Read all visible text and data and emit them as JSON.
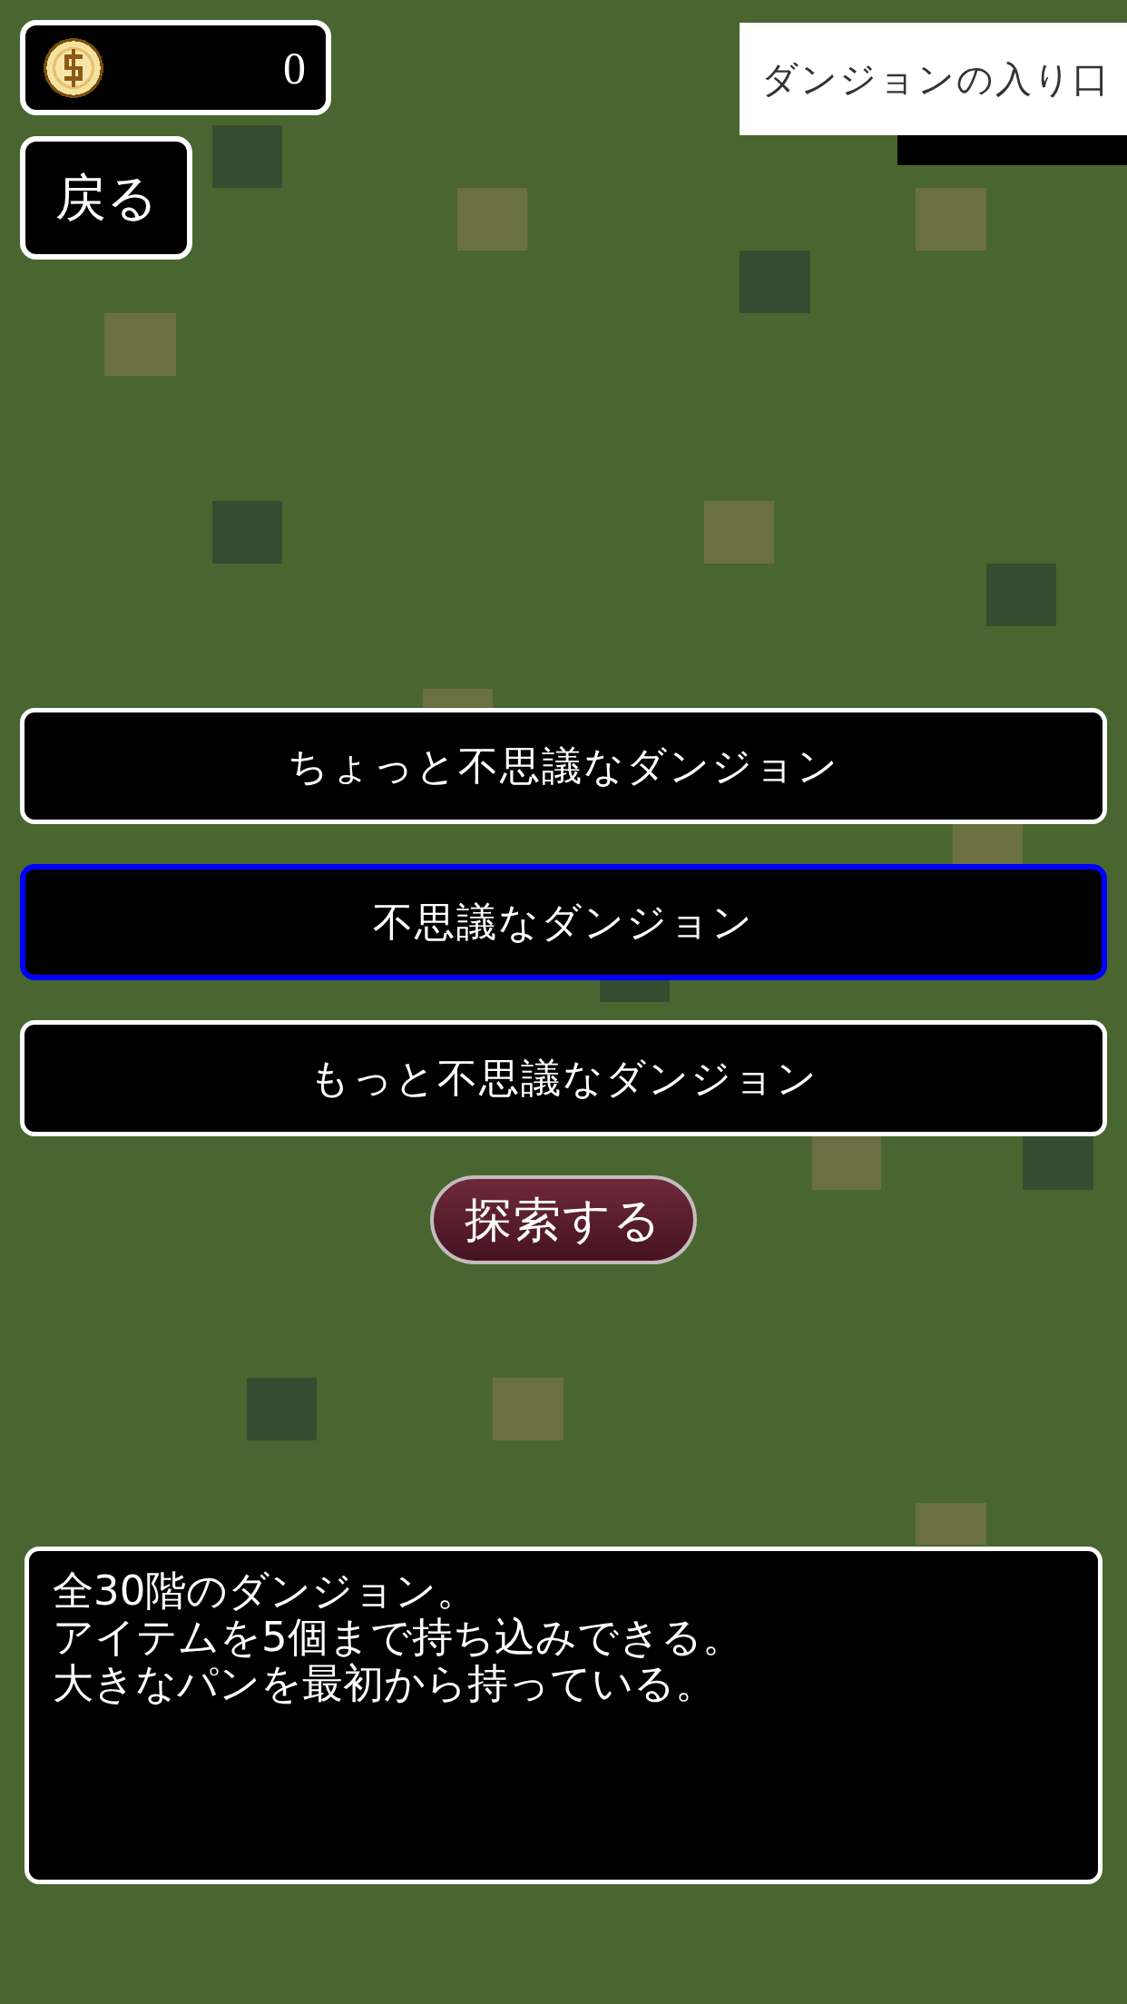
{
  "coins": {
    "amount": "0"
  },
  "back_button": {
    "label": "戻る"
  },
  "title_banner": {
    "title": "ダンジョンの入り口"
  },
  "dungeons": [
    {
      "label": "ちょっと不思議なダンジョン",
      "selected": false
    },
    {
      "label": "不思議なダンジョン",
      "selected": true
    },
    {
      "label": "もっと不思議なダンジョン",
      "selected": false
    }
  ],
  "explore_button": {
    "label": "探索する"
  },
  "description": {
    "lines": [
      "全30階のダンジョン。",
      "アイテムを5個まで持ち込みできる。",
      "大きなパンを最初から持っている。"
    ]
  }
}
